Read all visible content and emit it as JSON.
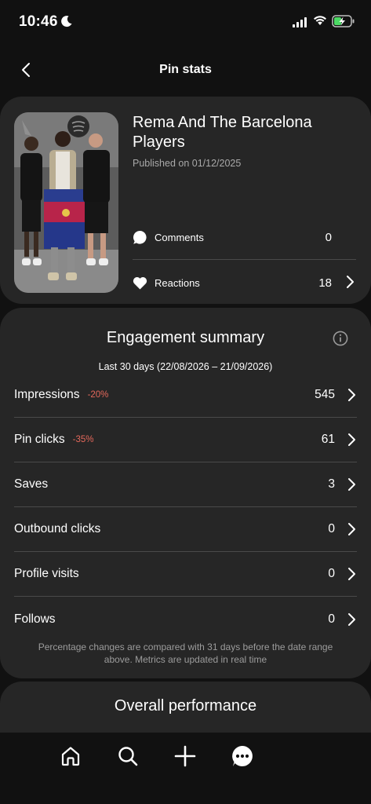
{
  "status_bar": {
    "time": "10:46",
    "icons": [
      "moon-icon",
      "signal-icon",
      "wifi-icon",
      "battery-charging-icon"
    ]
  },
  "nav": {
    "title": "Pin stats",
    "back_icon": "chevron-left-icon"
  },
  "pin": {
    "title": "Rema And The Barcelona Players",
    "published": "Published on 01/12/2025",
    "comments_label": "Comments",
    "comments_value": "0",
    "reactions_label": "Reactions",
    "reactions_value": "18"
  },
  "engagement": {
    "title": "Engagement summary",
    "date_range": "Last 30 days (22/08/2026 – 21/09/2026)",
    "metrics": [
      {
        "label": "Impressions",
        "change": "-20%",
        "value": "545"
      },
      {
        "label": "Pin clicks",
        "change": "-35%",
        "value": "61"
      },
      {
        "label": "Saves",
        "change": "",
        "value": "3"
      },
      {
        "label": "Outbound clicks",
        "change": "",
        "value": "0"
      },
      {
        "label": "Profile visits",
        "change": "",
        "value": "0"
      },
      {
        "label": "Follows",
        "change": "",
        "value": "0"
      }
    ],
    "note": "Percentage changes are compared with 31 days before the date range above. Metrics are updated in real time"
  },
  "overall": {
    "title": "Overall performance"
  },
  "bottom_nav": {
    "items": [
      "home-icon",
      "search-icon",
      "plus-icon",
      "messages-icon"
    ]
  },
  "colors": {
    "background": "#111111",
    "card": "#262626",
    "negative_change": "#e4685b",
    "battery_charging": "#4cd964"
  }
}
